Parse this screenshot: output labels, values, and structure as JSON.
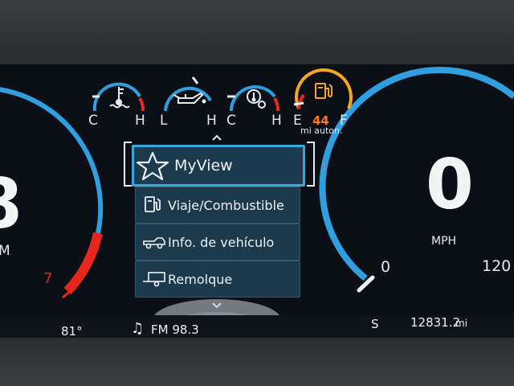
{
  "temp_gauges": [
    {
      "name": "coolant",
      "icon": "coolant-temperature-icon",
      "low": "C",
      "high": "H"
    },
    {
      "name": "oil",
      "icon": "oil-can-icon",
      "low": "L",
      "high": "H"
    },
    {
      "name": "transmission",
      "icon": "transmission-temperature-icon",
      "low": "C",
      "high": "H"
    }
  ],
  "fuel": {
    "low": "E",
    "high": "F",
    "range": "44",
    "unit": "mi auton.",
    "icon": "fuel-pump-icon"
  },
  "tachometer": {
    "partial_digit": "8",
    "partial_unit": "M",
    "redline_label": "7"
  },
  "speedometer": {
    "speed": "0",
    "unit": "MPH",
    "min_label": "0",
    "max_label": "120"
  },
  "menu": {
    "items": [
      {
        "label": "MyView",
        "icon": "star-icon",
        "selected": true
      },
      {
        "label": "Viaje/Combustible",
        "icon": "fuel-pump-icon",
        "selected": false
      },
      {
        "label": "Info. de vehículo",
        "icon": "pickup-truck-icon",
        "selected": false
      },
      {
        "label": "Remolque",
        "icon": "trailer-icon",
        "selected": false
      }
    ]
  },
  "status_bar": {
    "outside_temp": "81°",
    "radio": "FM 98.3",
    "compass": "S",
    "odometer": "12831.2",
    "odometer_unit": "mi"
  },
  "colors": {
    "gauge_blue": "#2f9fe0",
    "redline": "#e8261c",
    "fuel_orange": "#f5a623",
    "menu_bg": "#1c3a4c"
  }
}
